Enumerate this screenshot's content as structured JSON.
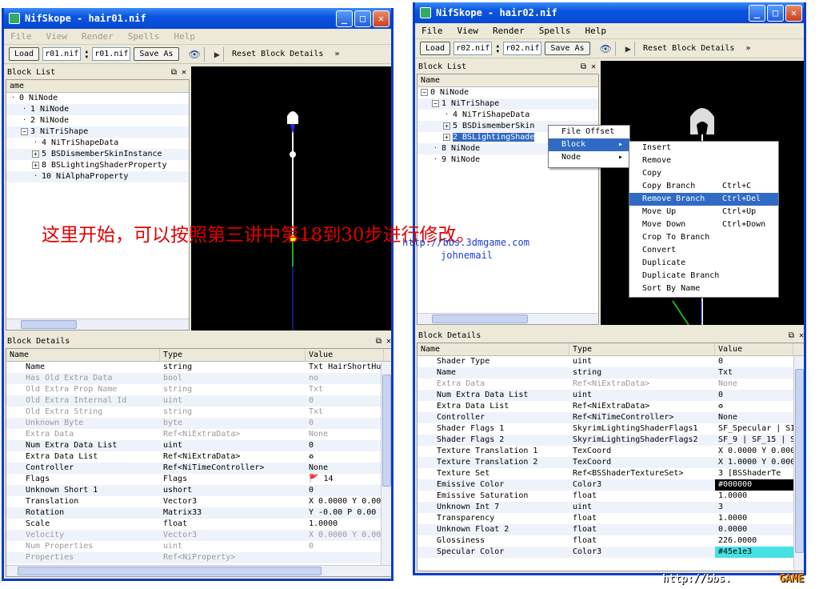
{
  "w1": {
    "title": "NifSkope - hair01.nif",
    "menu": [
      "File",
      "View",
      "Render",
      "Spells",
      "Help"
    ],
    "load": "Load",
    "field1": "r01.nif",
    "field2": "r01.nif",
    "saveas": "Save As",
    "reset": "Reset Block Details",
    "more": "»",
    "blocklist_title": "Block List",
    "blocklist_col": "ame",
    "tree": [
      {
        "label": "0 NiNode",
        "indent": 0,
        "exp": ""
      },
      {
        "label": "1 NiNode",
        "indent": 1,
        "exp": ""
      },
      {
        "label": "2 NiNode",
        "indent": 1,
        "exp": ""
      },
      {
        "label": "3 NiTriShape",
        "indent": 1,
        "exp": "−"
      },
      {
        "label": "4 NiTriShapeData",
        "indent": 2,
        "exp": ""
      },
      {
        "label": "5 BSDismemberSkinInstance",
        "indent": 2,
        "exp": "+"
      },
      {
        "label": "8 BSLightingShaderProperty",
        "indent": 2,
        "exp": "+"
      },
      {
        "label": "10 NiAlphaProperty",
        "indent": 2,
        "exp": ""
      }
    ],
    "details_title": "Block Details",
    "cols": [
      "Name",
      "Type",
      "Value"
    ],
    "rows": [
      {
        "n": "Name",
        "t": "string",
        "v": "Txt HairShortHum",
        "d": false
      },
      {
        "n": "Has Old Extra Data",
        "t": "bool",
        "v": "no",
        "d": true
      },
      {
        "n": "Old Extra Prop Name",
        "t": "string",
        "v": "Txt",
        "d": true
      },
      {
        "n": "Old Extra Internal Id",
        "t": "uint",
        "v": "0",
        "d": true
      },
      {
        "n": "Old Extra String",
        "t": "string",
        "v": "Txt",
        "d": true
      },
      {
        "n": "Unknown Byte",
        "t": "byte",
        "v": "0",
        "d": true
      },
      {
        "n": "Extra Data",
        "t": "Ref<NiExtraData>",
        "v": "None",
        "d": true
      },
      {
        "n": "Num Extra Data List",
        "t": "uint",
        "v": "0",
        "d": false
      },
      {
        "n": "Extra Data List",
        "t": "Ref<NiExtraData>",
        "v": "♻",
        "d": false
      },
      {
        "n": "Controller",
        "t": "Ref<NiTimeController>",
        "v": "None",
        "d": false
      },
      {
        "n": "Flags",
        "t": "Flags",
        "v": "🚩 14",
        "d": false
      },
      {
        "n": "Unknown Short 1",
        "t": "ushort",
        "v": "0",
        "d": false
      },
      {
        "n": "Translation",
        "t": "Vector3",
        "v": "X 0.0000 Y 0.00",
        "d": false
      },
      {
        "n": "Rotation",
        "t": "Matrix33",
        "v": "Y -0.00 P 0.00",
        "d": false
      },
      {
        "n": "Scale",
        "t": "float",
        "v": "1.0000",
        "d": false
      },
      {
        "n": "Velocity",
        "t": "Vector3",
        "v": "X 0.0000 Y 0.00",
        "d": true
      },
      {
        "n": "Num Properties",
        "t": "uint",
        "v": "0",
        "d": true
      },
      {
        "n": "Properties",
        "t": "Ref<NiProperty>",
        "v": "",
        "d": true
      }
    ]
  },
  "w2": {
    "title": "NifSkope - hair02.nif",
    "menu": [
      "File",
      "View",
      "Render",
      "Spells",
      "Help"
    ],
    "load": "Load",
    "field1": "r02.nif",
    "field2": "r02.nif",
    "saveas": "Save As",
    "reset": "Reset Block Details",
    "more": "»",
    "blocklist_title": "Block List",
    "blocklist_col": "Name",
    "tree": [
      {
        "label": "0 NiNode",
        "indent": 0,
        "exp": "−"
      },
      {
        "label": "1 NiTriShape",
        "indent": 1,
        "exp": "−"
      },
      {
        "label": "4 NiTriShapeData",
        "indent": 2,
        "exp": ""
      },
      {
        "label": "5 BSDismemberSkin",
        "indent": 2,
        "exp": "+"
      },
      {
        "label": "2 BSLightingShade",
        "indent": 2,
        "exp": "+"
      },
      {
        "label": "8 NiNode",
        "indent": 1,
        "exp": ""
      },
      {
        "label": "9 NiNode",
        "indent": 1,
        "exp": ""
      }
    ],
    "details_title": "Block Details",
    "cols": [
      "Name",
      "Type",
      "Value"
    ],
    "rows": [
      {
        "n": "Shader Type",
        "t": "uint",
        "v": "0",
        "d": false
      },
      {
        "n": "Name",
        "t": "string",
        "v": "Txt",
        "d": false
      },
      {
        "n": "Extra Data",
        "t": "Ref<NiExtraData>",
        "v": "None",
        "d": true
      },
      {
        "n": "Num Extra Data List",
        "t": "uint",
        "v": "0",
        "d": false
      },
      {
        "n": "Extra Data List",
        "t": "Ref<NiExtraData>",
        "v": "♻",
        "d": false
      },
      {
        "n": "Controller",
        "t": "Ref<NiTimeController>",
        "v": "None",
        "d": false
      },
      {
        "n": "Shader Flags 1",
        "t": "SkyrimLightingShaderFlags1",
        "v": "SF_Specular | SI",
        "d": false
      },
      {
        "n": "Shader Flags 2",
        "t": "SkyrimLightingShaderFlags2",
        "v": "SF_9 | SF_15 | S",
        "d": false
      },
      {
        "n": "Texture Translation 1",
        "t": "TexCoord",
        "v": "X 0.0000 Y 0.000",
        "d": false
      },
      {
        "n": "Texture Translation 2",
        "t": "TexCoord",
        "v": "X 1.0000 Y 0.000",
        "d": false
      },
      {
        "n": "Texture Set",
        "t": "Ref<BSShaderTextureSet>",
        "v": "3 [BSShaderTe",
        "d": false
      },
      {
        "n": "Emissive Color",
        "t": "Color3",
        "v": "#000000",
        "d": false
      },
      {
        "n": "Emissive Saturation",
        "t": "float",
        "v": "1.0000",
        "d": false
      },
      {
        "n": "Unknown Int 7",
        "t": "uint",
        "v": "3",
        "d": false
      },
      {
        "n": "Transparency",
        "t": "float",
        "v": "1.0000",
        "d": false
      },
      {
        "n": "Unknown Float 2",
        "t": "float",
        "v": "0.0000",
        "d": false
      },
      {
        "n": "Glossiness",
        "t": "float",
        "v": "226.0000",
        "d": false
      },
      {
        "n": "Specular Color",
        "t": "Color3",
        "v": "#45e1e3",
        "d": false
      }
    ]
  },
  "ctx": {
    "main": [
      "File Offset",
      "Block",
      "Node"
    ],
    "sub": [
      {
        "l": "Insert",
        "k": ""
      },
      {
        "l": "Remove",
        "k": ""
      },
      {
        "l": "Copy",
        "k": ""
      },
      {
        "l": "Copy Branch",
        "k": "Ctrl+C"
      },
      {
        "l": "Remove Branch",
        "k": "Ctrl+Del"
      },
      {
        "l": "Move Up",
        "k": "Ctrl+Up"
      },
      {
        "l": "Move Down",
        "k": "Ctrl+Down"
      },
      {
        "l": "Crop To Branch",
        "k": ""
      },
      {
        "l": "Convert",
        "k": ""
      },
      {
        "l": "Duplicate",
        "k": ""
      },
      {
        "l": "Duplicate Branch",
        "k": ""
      },
      {
        "l": "Sort By Name",
        "k": ""
      }
    ]
  },
  "overlay": {
    "text": "这里开始，可以按照第三讲中第18到30步进行修改。",
    "url": "http://bbs.3dmgame.com",
    "author": "johnemail",
    "watermark": "http://bbs.",
    "watermark2": "GAME"
  },
  "colors": {
    "titlebar": "#0a55e0",
    "selection": "#316ac5",
    "overlay_text": "#e00000"
  }
}
